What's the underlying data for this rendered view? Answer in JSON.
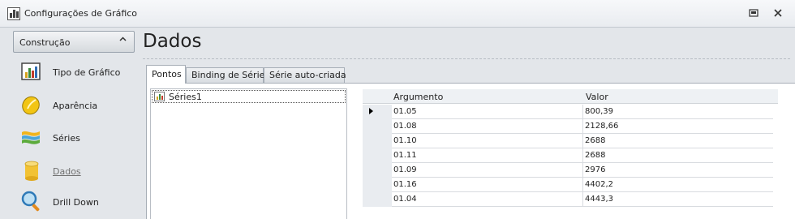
{
  "window": {
    "title": "Configurações de Gráfico",
    "restore_icon": "restore-icon",
    "close_icon": "close-icon"
  },
  "sidebar": {
    "group": {
      "label": "Construção",
      "chevron": "chevron-up-icon"
    },
    "items": [
      {
        "label": "Tipo de Gráfico",
        "icon": "chart-type-icon"
      },
      {
        "label": "Aparência",
        "icon": "appearance-icon"
      },
      {
        "label": "Séries",
        "icon": "series-icon"
      },
      {
        "label": "Dados",
        "icon": "data-icon",
        "active": true
      },
      {
        "label": "Drill Down",
        "icon": "drill-down-icon"
      }
    ]
  },
  "main": {
    "title": "Dados",
    "tabs": [
      {
        "label": "Pontos",
        "active": true
      },
      {
        "label": "Binding de Séries"
      },
      {
        "label": "Série auto-criada"
      }
    ],
    "series_list": [
      {
        "label": "Séries1",
        "icon": "series-chart-icon"
      }
    ],
    "grid": {
      "columns": [
        "Argumento",
        "Valor"
      ],
      "rows": [
        {
          "argument": "01.05",
          "value": "800,39",
          "current": true
        },
        {
          "argument": "01.08",
          "value": "2128,66"
        },
        {
          "argument": "01.10",
          "value": "2688"
        },
        {
          "argument": "01.11",
          "value": "2688"
        },
        {
          "argument": "01.09",
          "value": "2976"
        },
        {
          "argument": "01.16",
          "value": "4402,2"
        },
        {
          "argument": "01.04",
          "value": "4443,3"
        }
      ]
    }
  }
}
